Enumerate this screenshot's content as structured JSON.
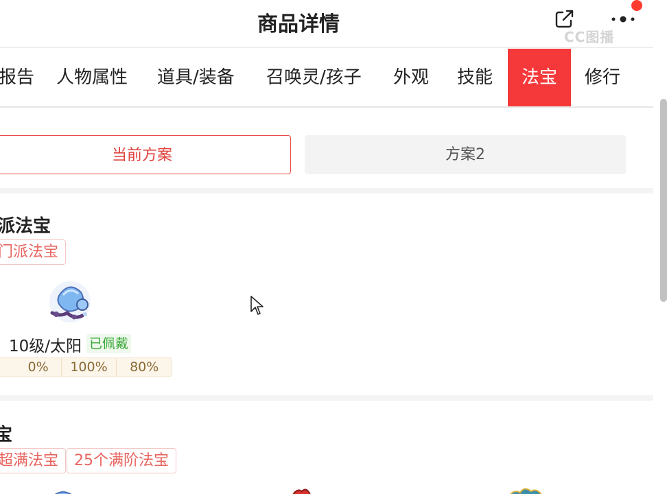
{
  "header": {
    "title": "商品详情",
    "share_icon": "share-icon",
    "more_icon": "more-dots-icon",
    "watermark": "CC图播"
  },
  "tabs": [
    {
      "label": "报告",
      "active": false
    },
    {
      "label": "人物属性",
      "active": false
    },
    {
      "label": "道具/装备",
      "active": false
    },
    {
      "label": "召唤灵/孩子",
      "active": false
    },
    {
      "label": "外观",
      "active": false
    },
    {
      "label": "技能",
      "active": false
    },
    {
      "label": "法宝",
      "active": true
    },
    {
      "label": "修行",
      "active": false
    }
  ],
  "plans": {
    "current": "当前方案",
    "plan2": "方案2"
  },
  "section1": {
    "title": "派法宝",
    "tag": "门派法宝",
    "item": {
      "level": "10级/太阳",
      "badge": "已佩戴",
      "stats": [
        "0%",
        "100%",
        "80%"
      ]
    }
  },
  "section2": {
    "title": "宝",
    "tags": [
      "超满法宝",
      "25个满阶法宝"
    ]
  },
  "colors": {
    "accent": "#f5383a",
    "tag_text": "#e8645f",
    "worn_green": "#37a635",
    "stat_text": "#8a6a35"
  }
}
